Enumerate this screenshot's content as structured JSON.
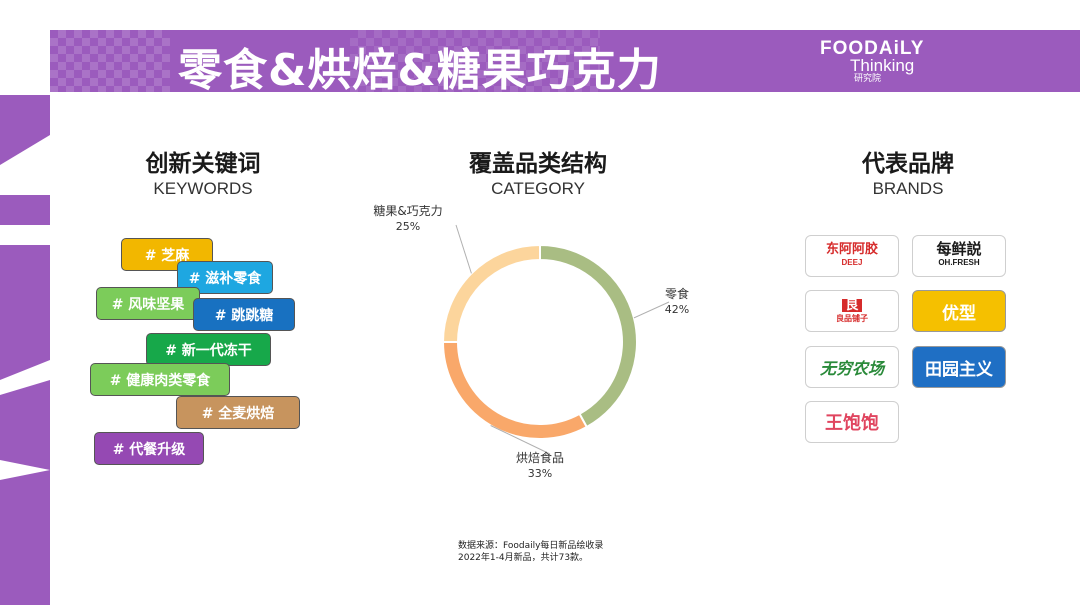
{
  "header": {
    "title": "零食&烘焙&糖果巧克力",
    "logo_line1": "FOODAiLY",
    "logo_line2": "Thinking",
    "logo_line3": "研究院"
  },
  "keywords": {
    "heading_zh": "创新关键词",
    "heading_en": "KEYWORDS",
    "tags": [
      {
        "label": "# 芝麻",
        "color": "#f2b700"
      },
      {
        "label": "# 滋补零食",
        "color": "#1ea7e1"
      },
      {
        "label": "# 风味坚果",
        "color": "#7ccc5a"
      },
      {
        "label": "# 跳跳糖",
        "color": "#1871c1"
      },
      {
        "label": "# 新一代冻干",
        "color": "#17a84a"
      },
      {
        "label": "# 健康肉类零食",
        "color": "#7ccc5a"
      },
      {
        "label": "# 全麦烘焙",
        "color": "#c7945e"
      },
      {
        "label": "# 代餐升级",
        "color": "#9549b3"
      }
    ]
  },
  "category": {
    "heading_zh": "覆盖品类结构",
    "heading_en": "CATEGORY"
  },
  "chart_data": {
    "type": "pie",
    "donut": true,
    "slices": [
      {
        "label": "零食",
        "value": 42,
        "display": "42%",
        "color": "#a9bd83"
      },
      {
        "label": "烘焙食品",
        "value": 33,
        "display": "33%",
        "color": "#f9a86a"
      },
      {
        "label": "糖果&巧克力",
        "value": 25,
        "display": "25%",
        "color": "#fcd59c"
      }
    ]
  },
  "brands": {
    "heading_zh": "代表品牌",
    "heading_en": "BRANDS",
    "items": [
      {
        "label": "东阿阿胶",
        "sub": "DEEJ",
        "color": "#d62b2b",
        "bg": "#ffffff"
      },
      {
        "label": "每鲜説",
        "sub": "OH.FRESH",
        "color": "#1a1a1a",
        "bg": "#ffffff"
      },
      {
        "label": "良",
        "sub": "良品铺子",
        "color": "#d62b2b",
        "bg": "#ffffff"
      },
      {
        "label": "优型",
        "sub": "",
        "color": "#ffffff",
        "bg": "#f5c000"
      },
      {
        "label": "无穷农场",
        "sub": "",
        "color": "#2a8a3a",
        "bg": "#ffffff"
      },
      {
        "label": "田园主义",
        "sub": "",
        "color": "#ffffff",
        "bg": "#1f6fc4"
      },
      {
        "label": "王饱饱",
        "sub": "",
        "color": "#e0455f",
        "bg": "#ffffff"
      }
    ]
  },
  "source": {
    "line1": "数据来源：Foodaily每日新品绘收录",
    "line2": "2022年1-4月新品，共计73款。"
  },
  "colors": {
    "accent": "#9b5bbd"
  }
}
